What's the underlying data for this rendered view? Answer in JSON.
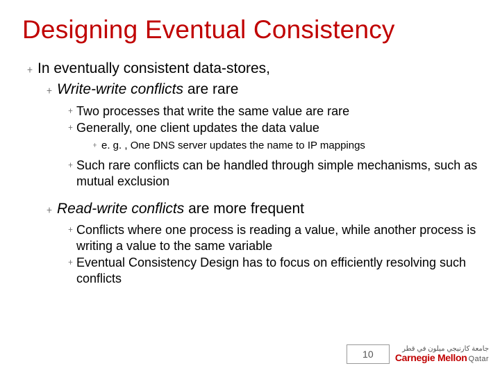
{
  "title": "Designing Eventual Consistency",
  "bullets": {
    "l1_intro": "In eventually consistent data-stores,",
    "ww_em": "Write-write conflicts",
    "ww_tail": " are rare",
    "ww_sub1": "Two processes that write the same value are rare",
    "ww_sub2": "Generally, one client updates the data value",
    "ww_sub2_ex": "e. g. , One DNS server updates the name to IP mappings",
    "ww_sub3": "Such rare conflicts can be handled through simple mechanisms, such as mutual exclusion",
    "rw_em": "Read-write conflicts",
    "rw_tail": " are more frequent",
    "rw_sub1": "Conflicts where one process is reading a value, while another process is writing a value to the same variable",
    "rw_sub2": "Eventual Consistency Design has to focus on efficiently resolving such conflicts"
  },
  "footer": {
    "page_number": "10",
    "logo_arabic": "جامعة كارنيجي ميلون في قطر",
    "logo_main": "Carnegie Mellon",
    "logo_sub": "Qatar"
  }
}
